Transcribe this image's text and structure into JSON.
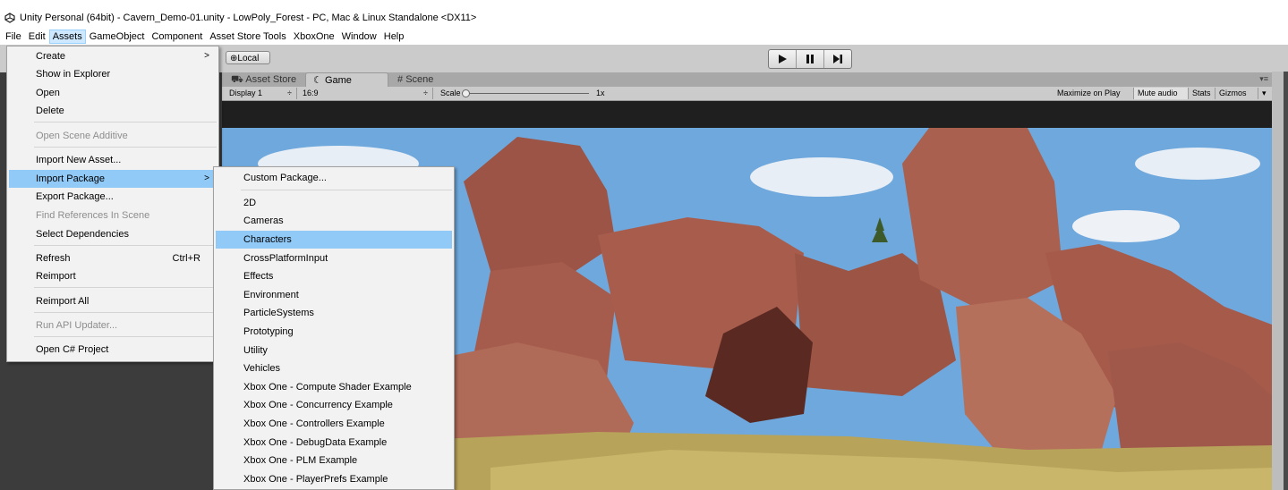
{
  "window": {
    "title": "Unity Personal (64bit) - Cavern_Demo-01.unity - LowPoly_Forest - PC, Mac & Linux Standalone <DX11>"
  },
  "menubar": {
    "items": [
      "File",
      "Edit",
      "Assets",
      "GameObject",
      "Component",
      "Asset Store Tools",
      "XboxOne",
      "Window",
      "Help"
    ],
    "active": "Assets"
  },
  "toolbar": {
    "local_label": "Local",
    "play_icon": "play-icon",
    "pause_icon": "pause-icon",
    "step_icon": "step-icon"
  },
  "tabs": {
    "asset_store": "Asset Store",
    "game": "Game",
    "scene": "Scene"
  },
  "game_toolbar": {
    "display": "Display 1",
    "display_arrow": "÷",
    "aspect": "16:9",
    "aspect_arrow": "÷",
    "scale_label": "Scale",
    "scale_value": "1x",
    "maximize": "Maximize on Play",
    "mute": "Mute audio",
    "stats": "Stats",
    "gizmos": "Gizmos"
  },
  "assets_menu": {
    "items": [
      {
        "label": "Create",
        "arrow": ">"
      },
      {
        "label": "Show in Explorer"
      },
      {
        "label": "Open"
      },
      {
        "label": "Delete"
      },
      {
        "label": "Open Scene Additive",
        "disabled": true
      },
      {
        "label": "Import New Asset..."
      },
      {
        "label": "Import Package",
        "arrow": ">",
        "highlighted": true
      },
      {
        "label": "Export Package..."
      },
      {
        "label": "Find References In Scene",
        "disabled": true
      },
      {
        "label": "Select Dependencies"
      },
      {
        "label": "Refresh",
        "shortcut": "Ctrl+R"
      },
      {
        "label": "Reimport"
      },
      {
        "label": "Reimport All"
      },
      {
        "label": "Run API Updater...",
        "disabled": true
      },
      {
        "label": "Open C# Project"
      }
    ]
  },
  "import_package_menu": {
    "items": [
      {
        "label": "Custom Package..."
      },
      {
        "label": "2D"
      },
      {
        "label": "Cameras"
      },
      {
        "label": "Characters",
        "highlighted": true
      },
      {
        "label": "CrossPlatformInput"
      },
      {
        "label": "Effects"
      },
      {
        "label": "Environment"
      },
      {
        "label": "ParticleSystems"
      },
      {
        "label": "Prototyping"
      },
      {
        "label": "Utility"
      },
      {
        "label": "Vehicles"
      },
      {
        "label": "Xbox One - Compute Shader Example"
      },
      {
        "label": "Xbox One - Concurrency Example"
      },
      {
        "label": "Xbox One - Controllers Example"
      },
      {
        "label": "Xbox One - DebugData Example"
      },
      {
        "label": "Xbox One - PLM Example"
      },
      {
        "label": "Xbox One - PlayerPrefs Example"
      }
    ]
  },
  "colors": {
    "highlight": "#91c9f7",
    "menu_bg": "#f2f2f2",
    "sky": "#6fa8dc",
    "rock": "#a55a4a",
    "ground": "#b8a35a"
  }
}
